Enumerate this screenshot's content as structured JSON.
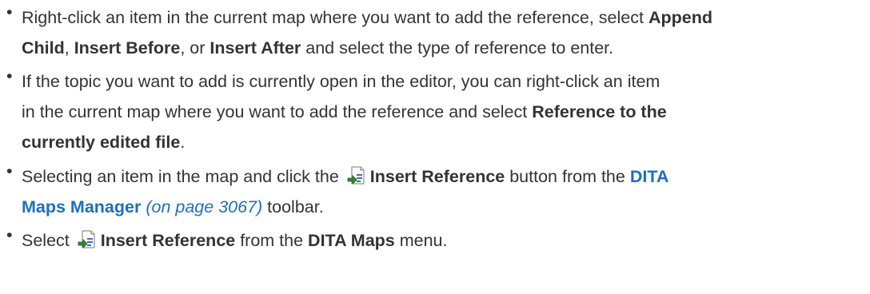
{
  "items": [
    {
      "line1": {
        "t1": "Right-click an item in the current map where you want to add the reference, select ",
        "b1": "Append"
      },
      "line2": {
        "b1": "Child",
        "t1": ", ",
        "b2": "Insert Before",
        "t2": ", or ",
        "b3": "Insert After",
        "t3": " and select the type of reference to enter."
      }
    },
    {
      "line1": {
        "t1": "If the topic you want to add is currently open in the editor, you can right-click an item"
      },
      "line2": {
        "t1": "in the current map where you want to add the reference and select ",
        "b1": "Reference to the"
      },
      "line3": {
        "b1": "currently edited file",
        "t1": "."
      }
    },
    {
      "line1": {
        "t1": "Selecting an item in the map and click the ",
        "icon": "insert-reference-icon",
        "b1": "Insert Reference",
        "t2": " button from the ",
        "link1": "DITA"
      },
      "line2": {
        "link1": "Maps Manager",
        "page_ref": "(on page 3067)",
        "t1": " toolbar."
      }
    },
    {
      "line1": {
        "t1": "Select ",
        "icon": "insert-reference-icon",
        "b1": "Insert Reference",
        "t2": " from the ",
        "b2": "DITA Maps",
        "t3": " menu."
      }
    }
  ],
  "colors": {
    "text": "#333333",
    "link": "#1f6fb8"
  }
}
